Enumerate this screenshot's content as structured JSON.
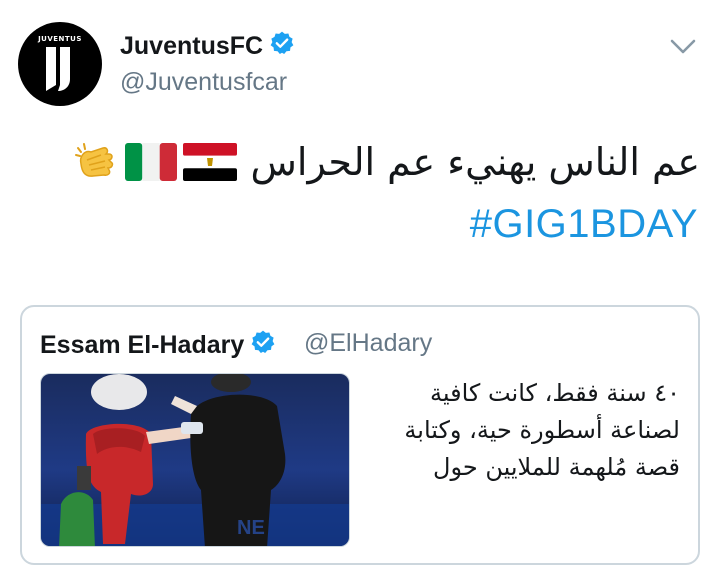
{
  "author": {
    "display_name": "JuventusFC",
    "handle": "@Juventusfcar",
    "avatar_wordmark": "JUVENTUS"
  },
  "tweet": {
    "text": "عم الناس يهنيء عم الحراس",
    "hashtag": "#GIG1BDAY",
    "emojis": [
      "egypt-flag",
      "italy-flag",
      "clapping-hands"
    ]
  },
  "quoted_tweet": {
    "display_name": "Essam El-Hadary",
    "handle": "@ElHadary",
    "lines": [
      "٤٠ سنة فقط، كانت كافية",
      "لصناعة أسطورة حية، وكتابة",
      "قصة مُلهمة للملايين حول"
    ]
  },
  "colors": {
    "link": "#1b95e0",
    "verified": "#1da1f2",
    "secondary_text": "#657786",
    "border": "#ccd6dd"
  }
}
